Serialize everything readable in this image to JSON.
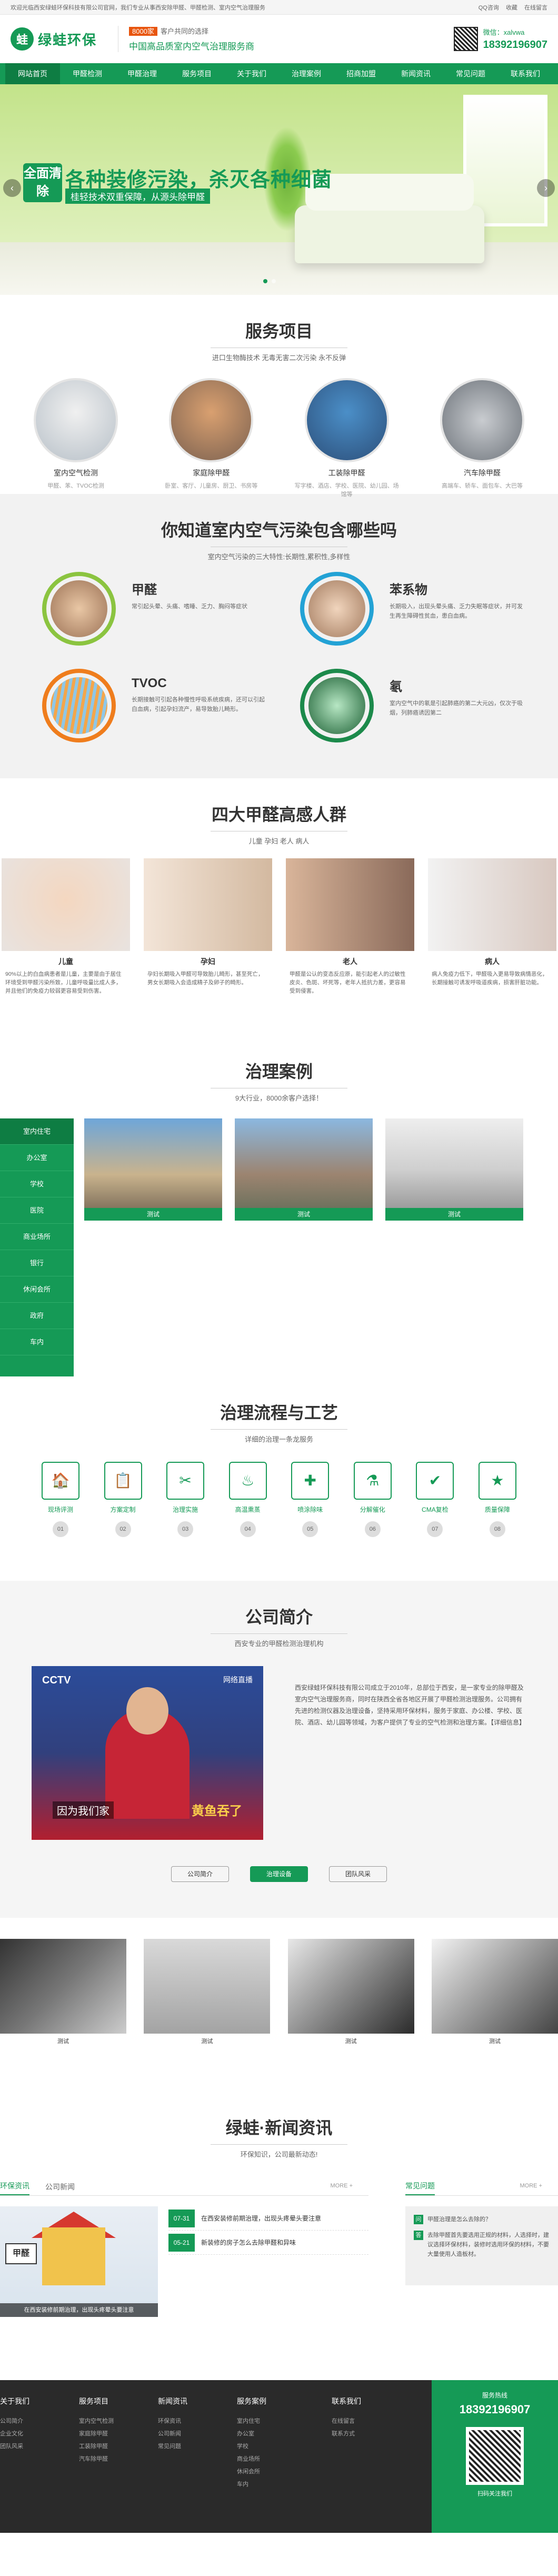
{
  "topbar": {
    "left": "欢迎光临西安绿蛙环保科技有限公司官网，我们专业从事西安除甲醛、甲醛检测、室内空气治理服务",
    "links": [
      "QQ咨询",
      "收藏",
      "在线留言"
    ]
  },
  "header": {
    "logo_mark": "蛙",
    "logo_text": "绿蛙环保",
    "slogan_badge": "8000家",
    "slogan_line1": "客户共同的选择",
    "slogan_line2": "中国高品质室内空气治理服务商",
    "wechat": "微信：xalvwa",
    "phone": "18392196907"
  },
  "nav": [
    "网站首页",
    "甲醛检测",
    "甲醛治理",
    "服务项目",
    "关于我们",
    "治理案例",
    "招商加盟",
    "新闻资讯",
    "常见问题",
    "联系我们"
  ],
  "banner": {
    "badge": "全面清除",
    "headline": "各种装修污染，杀灭各种细菌",
    "subline": "桂轻技术双重保障，从源头除甲醛"
  },
  "services": {
    "title": "服务项目",
    "subtitle": "进口生物酶技术 无毒无害二次污染 永不反弹",
    "items": [
      {
        "name": "室内空气检测",
        "sub": "甲醛、苯、TVOC检测"
      },
      {
        "name": "家庭除甲醛",
        "sub": "卧室、客厅、儿童房、厨卫、书房等"
      },
      {
        "name": "工装除甲醛",
        "sub": "写字楼、酒店、学校、医院、幼儿园、场馆等"
      },
      {
        "name": "汽车除甲醛",
        "sub": "高端车、轿车、面包车、大巴等"
      }
    ]
  },
  "pollution": {
    "title": "你知道室内空气污染包含哪些吗",
    "subtitle": "室内空气污染的三大特性:长期性,累积性,多样性",
    "items": [
      {
        "name": "甲醛",
        "desc": "常引起头晕、头痛、嗜睡、乏力、胸闷等症状"
      },
      {
        "name": "苯系物",
        "desc": "长期吸入，出现头晕头痛、乏力失眠等症状，并可发生再生障碍性贫血，患白血病。"
      },
      {
        "name": "TVOC",
        "desc": "长期接触可引起各种慢性呼吸系统疾病，还可以引起白血病，引起孕妇流产，易导致胎儿畸形。"
      },
      {
        "name": "氡",
        "desc": "室内空气中的氡是引起肺癌的第二大元凶，仅次于吸烟，列肺癌诱因第二"
      }
    ]
  },
  "groups": {
    "title": "四大甲醛高感人群",
    "subtitle": "儿童 孕妇 老人 病人",
    "items": [
      {
        "name": "儿童",
        "desc": "90%以上的白血病患者是儿童，主要是由于居住环境受到甲醛污染所致，儿童呼吸量比成人多，并且他们的免疫力较弱更容易受到伤害。"
      },
      {
        "name": "孕妇",
        "desc": "孕妇长期吸入甲醛可导致胎儿畸形，甚至死亡，男女长期吸入会造成精子及卵子的畸形。"
      },
      {
        "name": "老人",
        "desc": "甲醛是公认的变态反应原，能引起老人的过敏性皮炎、色斑、坏死等，老年人抵抗力差，更容易受到侵害。"
      },
      {
        "name": "病人",
        "desc": "病人免疫力低下，甲醛吸入更易导致病情恶化，长期接触可诱发呼吸道疾病，损害肝脏功能。"
      }
    ]
  },
  "cases": {
    "title": "治理案例",
    "subtitle": "9大行业，8000余客户选择！",
    "menu": [
      "室内住宅",
      "办公室",
      "学校",
      "医院",
      "商业场所",
      "银行",
      "休闲会所",
      "政府",
      "车内"
    ],
    "items": [
      {
        "caption": "测试"
      },
      {
        "caption": "测试"
      },
      {
        "caption": "测试"
      }
    ]
  },
  "process": {
    "title": "治理流程与工艺",
    "subtitle": "详细的治理一条龙服务",
    "steps": [
      {
        "name": "现场评测",
        "icon": "🏠",
        "no": "01"
      },
      {
        "name": "方案定制",
        "icon": "📋",
        "no": "02"
      },
      {
        "name": "治理实施",
        "icon": "✂",
        "no": "03"
      },
      {
        "name": "高温熏蒸",
        "icon": "♨",
        "no": "04"
      },
      {
        "name": "喷涂除味",
        "icon": "✚",
        "no": "05"
      },
      {
        "name": "分解催化",
        "icon": "⚗",
        "no": "06"
      },
      {
        "name": "CMA复检",
        "icon": "✔",
        "no": "07"
      },
      {
        "name": "质量保障",
        "icon": "★",
        "no": "08"
      }
    ]
  },
  "about": {
    "title": "公司简介",
    "subtitle": "西安专业的甲醛检测治理机构",
    "video_logo": "CCTV",
    "video_logo2": "网络直播",
    "video_cap1": "因为我们家",
    "video_cap2": "黄鱼吞了",
    "text": "西安绿蛙环保科技有限公司成立于2010年，总部位于西安，是一家专业的除甲醛及室内空气治理服务商，同时在陕西全省各地区开展了甲醛检测治理服务。公司拥有先进的检测仪器及治理设备，坚持采用环保材料，服务于家庭、办公楼、学校、医院、酒店、幼儿园等领域，为客户提供了专业的空气检测和治理方案。【详细信息】",
    "buttons": [
      "公司简介",
      "治理设备",
      "团队风采"
    ],
    "active_button": 1,
    "equipment": [
      {
        "caption": "测试"
      },
      {
        "caption": "测试"
      },
      {
        "caption": "测试"
      },
      {
        "caption": "测试"
      }
    ]
  },
  "news": {
    "title": "绿蛙·新闻资讯",
    "subtitle": "环保知识，公司最新动态!",
    "tabs": [
      "环保资讯",
      "公司新闻"
    ],
    "more": "MORE +",
    "image_caption": "在西安装修前期治理，出现头疼晕头要注意",
    "image_tag": "甲醛",
    "items": [
      {
        "date": "07-31",
        "title": "在西安装修前期治理，出现头疼晕头要注意"
      },
      {
        "date": "05-21",
        "title": "新装修的房子怎么去除甲醛和异味"
      }
    ],
    "faq_title": "常见问题",
    "faq_more": "MORE +",
    "faq": [
      {
        "q": "问",
        "text": "甲醛治理是怎么去除的？"
      },
      {
        "q": "答",
        "text": "去除甲醛首先要选用正规的材料，人选择时，建议选择环保材料，装修时选用环保的材料，不要大量使用人造板材。"
      }
    ]
  },
  "footer": {
    "cols": [
      {
        "title": "关于我们",
        "links": [
          "公司简介",
          "企业文化",
          "团队风采"
        ]
      },
      {
        "title": "服务项目",
        "links": [
          "室内空气检测",
          "家庭除甲醛",
          "工装除甲醛",
          "汽车除甲醛"
        ]
      },
      {
        "title": "新闻资讯",
        "links": [
          "环保资讯",
          "公司新闻",
          "常见问题"
        ]
      },
      {
        "title": "服务案例",
        "links": [
          "室内住宅",
          "办公室",
          "学校",
          "商业场所",
          "休闲会所",
          "车内"
        ]
      },
      {
        "title": "联系我们",
        "links": [
          "在线留言",
          "联系方式"
        ]
      }
    ],
    "hotline_label": "服务热线",
    "hotline": "18392196907",
    "qr_label": "扫码关注我们"
  },
  "colors": {
    "brand": "#159a56",
    "accent": "#e8550e"
  }
}
